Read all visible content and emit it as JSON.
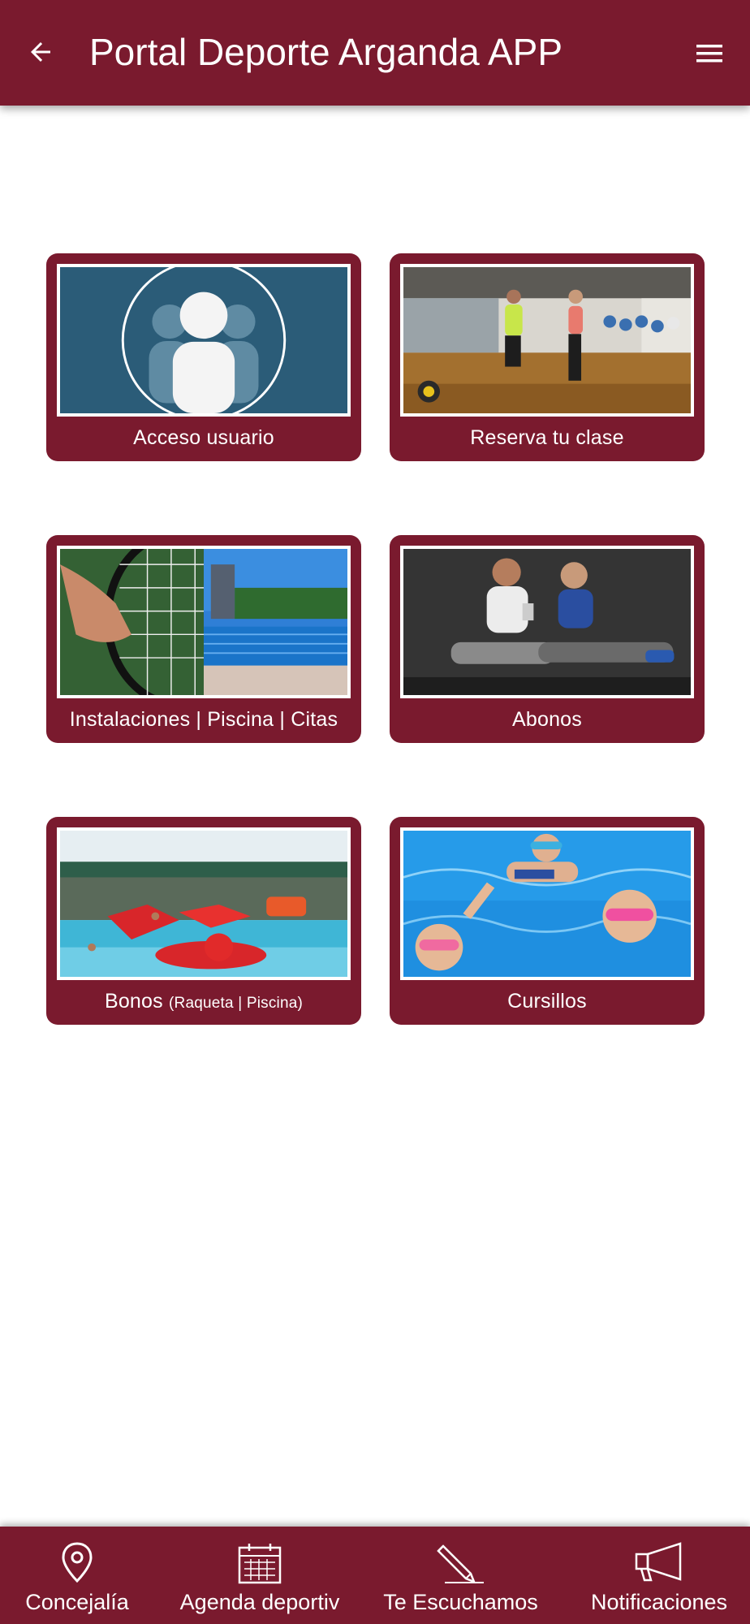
{
  "header": {
    "title": "Portal Deporte Arganda APP",
    "back_icon": "arrow-left-icon",
    "menu_icon": "hamburger-menu-icon",
    "background_color": "#7a1a2e"
  },
  "tiles": [
    {
      "label": "Acceso usuario",
      "image": "user-avatar-image"
    },
    {
      "label": "Reserva tu clase",
      "image": "fitness-class-image"
    },
    {
      "label": "Instalaciones | Piscina | Citas",
      "image": "tennis-and-pool-image"
    },
    {
      "label": "Abonos",
      "image": "couple-with-phone-image"
    },
    {
      "label_main": "Bonos",
      "label_small": "(Raqueta | Piscina)",
      "image": "indoor-pool-image"
    },
    {
      "label": "Cursillos",
      "image": "kids-swimming-image"
    }
  ],
  "bottom_nav": [
    {
      "label": "Concejalía",
      "icon": "location-pin-icon"
    },
    {
      "label": "Agenda deportiv",
      "icon": "calendar-icon"
    },
    {
      "label": "Te Escuchamos",
      "icon": "pencil-icon"
    },
    {
      "label": "Notificaciones",
      "icon": "megaphone-icon"
    }
  ]
}
